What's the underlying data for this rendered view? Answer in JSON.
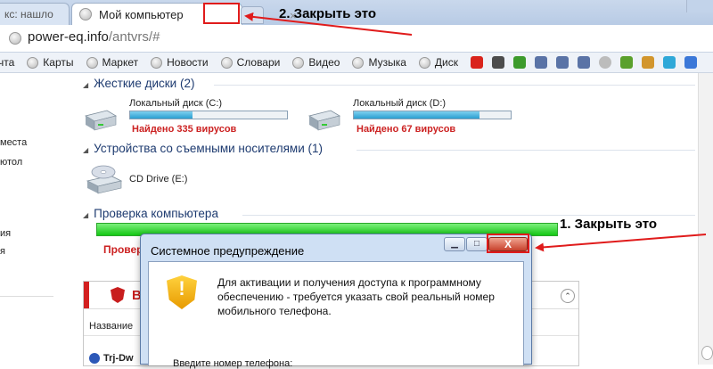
{
  "browser": {
    "tabs": [
      {
        "label": "кс: нашло"
      },
      {
        "label": "Мой компьютер",
        "active": true
      }
    ],
    "tab_close_glyph": "×",
    "address": {
      "domain": "power-eq.info",
      "path": "/antvrs/#"
    }
  },
  "bookmarks": [
    {
      "label": "чта",
      "icon": "globe-icon"
    },
    {
      "label": "Карты",
      "icon": "globe-icon"
    },
    {
      "label": "Маркет",
      "icon": "globe-icon"
    },
    {
      "label": "Новости",
      "icon": "globe-icon"
    },
    {
      "label": "Словари",
      "icon": "globe-icon"
    },
    {
      "label": "Видео",
      "icon": "globe-icon"
    },
    {
      "label": "Музыка",
      "icon": "globe-icon"
    },
    {
      "label": "Диск",
      "icon": "globe-icon"
    }
  ],
  "bookmark_icons": [
    {
      "name": "youtube-icon",
      "color": "#d9241c"
    },
    {
      "name": "tag-icon",
      "color": "#4c4c4c"
    },
    {
      "name": "leaf-icon",
      "color": "#3d9b2c"
    },
    {
      "name": "nix-icon",
      "color": "#5a73a6"
    },
    {
      "name": "nix-icon",
      "color": "#5a73a6"
    },
    {
      "name": "nix-icon",
      "color": "#5a73a6"
    },
    {
      "name": "globe-icon",
      "color": "#bcbcbc"
    },
    {
      "name": "plant-icon",
      "color": "#5aa02c"
    },
    {
      "name": "puzzle-icon",
      "color": "#d2962d"
    },
    {
      "name": "bubble-icon",
      "color": "#2fa8d8"
    },
    {
      "name": "google-icon",
      "color": "#3c78d8"
    }
  ],
  "sidebar": {
    "items": [
      "места",
      "ютол",
      "ия",
      "я"
    ]
  },
  "content": {
    "hard_drives": {
      "title": "Жесткие диски (2)",
      "drives": [
        {
          "label": "Локальный диск (C:)",
          "virus_text": "Найдено 335 вирусов",
          "fill": 0.4
        },
        {
          "label": "Локальный диск (D:)",
          "virus_text": "Найдено 67 вирусов",
          "fill": 0.8
        }
      ]
    },
    "removable": {
      "title": "Устройства со съемными носителями (1)",
      "drive_label": "CD Drive (E:)"
    },
    "scan": {
      "title": "Проверка компьютера",
      "progress": 1.0,
      "status_partial": "Провер"
    }
  },
  "virus_panel": {
    "title_partial": "В",
    "column_name": "Название",
    "row_name": "Trj-Dw"
  },
  "dialog": {
    "title": "Системное предупреждение",
    "minimize_glyph": "▁",
    "maximize_glyph": "□",
    "close_glyph": "X",
    "message": "Для активации и получения доступа к программному обеспечению - требуется указать свой реальный номер мобильного телефона.",
    "phone_label": "Введите номер телефона:"
  },
  "annotations": {
    "step1": "1. Закрыть это",
    "step2": "2. Закрыть это"
  },
  "colors": {
    "accent_red": "#e01b1b",
    "virus_red": "#cc2222",
    "progress_green": "#15c715",
    "drive_blue": "#2a9fd0"
  }
}
